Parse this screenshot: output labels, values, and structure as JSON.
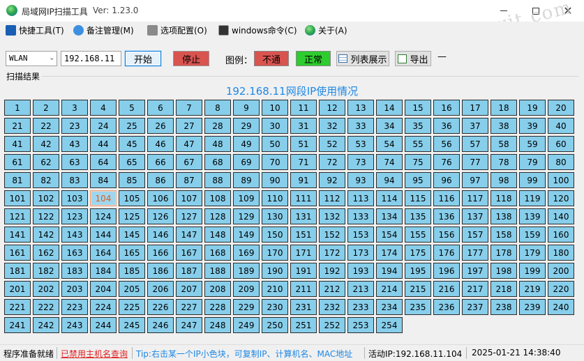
{
  "titlebar": {
    "title": "局域网IP扫描工具",
    "version": "Ver: 1.23.0",
    "close_glyph": "✕"
  },
  "watermark": "mpyit.com",
  "menu": [
    {
      "label": "快捷工具(T)",
      "icon": "tools-icon",
      "color": "#1a5fb4"
    },
    {
      "label": "备注管理(M)",
      "icon": "chat-bubble-icon",
      "color": "#3d8fe0"
    },
    {
      "label": "选项配置(O)",
      "icon": "wrench-icon",
      "color": "#7a7a7a"
    },
    {
      "label": "windows命令(C)",
      "icon": "console-icon",
      "color": "#333333"
    },
    {
      "label": "关于(A)",
      "icon": "globe-icon",
      "color": "#2fa84a"
    }
  ],
  "toolbar": {
    "nic": "WLAN",
    "nic_arrow": "⌄",
    "ip": "192.168.11",
    "start": "开始",
    "stop": "停止",
    "legend_label": "图例：",
    "legend_down": "不通",
    "legend_up": "正常",
    "list_view": "列表展示",
    "export": "导出",
    "dash": "—"
  },
  "results": {
    "section_label": "扫描结果",
    "grid_title": "192.168.11网段IP使用情况",
    "first_host": 1,
    "last_host": 254,
    "columns": 20,
    "hovered_host": "104",
    "cell_color": "#87ceeb"
  },
  "status": {
    "ready": "程序准备就绪",
    "hostname_disabled": "已禁用主机名查询",
    "tip": "Tip:右击某一个IP小色块，可复制IP、计算机名、MAC地址",
    "active_ip": "活动IP:192.168.11.104",
    "datetime": "2025-01-21 14:38:40"
  }
}
